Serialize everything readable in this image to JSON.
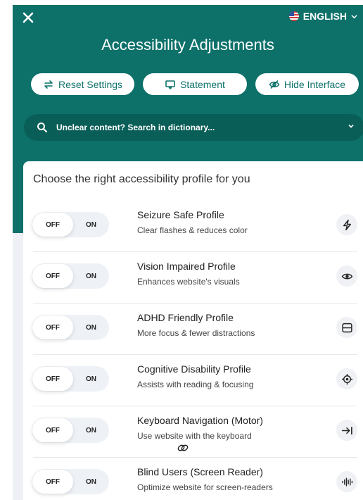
{
  "header": {
    "title": "Accessibility Adjustments",
    "language": "ENGLISH",
    "buttons": {
      "reset": "Reset Settings",
      "statement": "Statement",
      "hide": "Hide Interface"
    },
    "search_label": "Unclear content? Search in dictionary..."
  },
  "profiles": {
    "heading": "Choose the right accessibility profile for you",
    "toggle_off": "OFF",
    "toggle_on": "ON",
    "items": [
      {
        "name": "Seizure Safe Profile",
        "description": "Clear flashes & reduces color",
        "icon": "lightning-icon"
      },
      {
        "name": "Vision Impaired Profile",
        "description": "Enhances website's visuals",
        "icon": "eye-icon"
      },
      {
        "name": "ADHD Friendly Profile",
        "description": "More focus & fewer distractions",
        "icon": "focus-frame-icon"
      },
      {
        "name": "Cognitive Disability Profile",
        "description": "Assists with reading & focusing",
        "icon": "target-icon"
      },
      {
        "name": "Keyboard Navigation (Motor)",
        "description": "Use website with the keyboard",
        "icon": "arrow-to-line-icon"
      },
      {
        "name": "Blind Users (Screen Reader)",
        "description": "Optimize website for screen-readers",
        "icon": "audio-wave-icon"
      }
    ]
  },
  "colors": {
    "header_teal": "#0d716a",
    "search_bg": "#0a5e58",
    "panel_bg": "#eef0f5"
  }
}
